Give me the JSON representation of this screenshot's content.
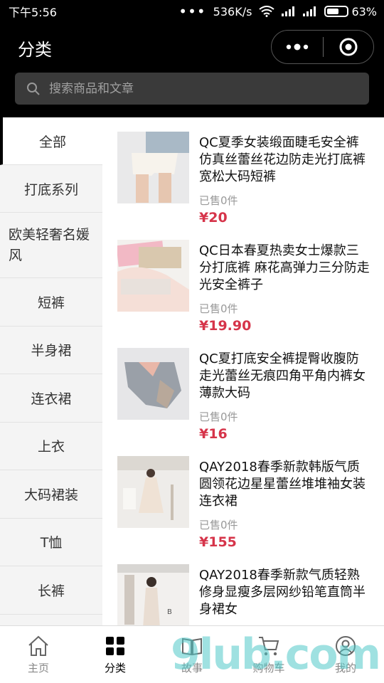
{
  "status_bar": {
    "time": "下午5:56",
    "speed": "536K/s",
    "battery": "63%",
    "battery_level": 0.63
  },
  "header": {
    "title": "分类",
    "search_placeholder": "搜索商品和文章"
  },
  "sidebar": {
    "items": [
      {
        "label": "全部",
        "active": true
      },
      {
        "label": "打底系列"
      },
      {
        "label": "欧美轻奢名媛风"
      },
      {
        "label": "短裤"
      },
      {
        "label": "半身裙"
      },
      {
        "label": "连衣裙"
      },
      {
        "label": "上衣"
      },
      {
        "label": "大码裙装"
      },
      {
        "label": "T恤"
      },
      {
        "label": "长裤"
      }
    ]
  },
  "products": [
    {
      "name": "QC夏季女装缎面睫毛安全裤仿真丝蕾丝花边防走光打底裤宽松大码短裤",
      "sold": "已售0件",
      "price": "¥20"
    },
    {
      "name": "QC日本春夏热卖女士爆款三分打底裤 麻花高弹力三分防走光安全裤子",
      "sold": "已售0件",
      "price": "¥19.90"
    },
    {
      "name": "QC夏打底安全裤提臀收腹防走光蕾丝无痕四角平角内裤女薄款大码",
      "sold": "已售0件",
      "price": "¥16"
    },
    {
      "name": "QAY2018春季新款韩版气质圆领花边星星蕾丝堆堆袖女装连衣裙",
      "sold": "已售0件",
      "price": "¥155"
    },
    {
      "name": "QAY2018春季新款气质轻熟修身显瘦多层网纱铅笔直筒半身裙女",
      "sold": "",
      "price": ""
    }
  ],
  "tabbar": {
    "tabs": [
      {
        "label": "主页",
        "icon": "home-icon"
      },
      {
        "label": "分类",
        "icon": "grid-icon",
        "active": true
      },
      {
        "label": "故事",
        "icon": "book-icon"
      },
      {
        "label": "购物车",
        "icon": "cart-icon"
      },
      {
        "label": "我的",
        "icon": "user-icon"
      }
    ]
  },
  "watermark": "9lub.com",
  "colors": {
    "price": "#d6344a",
    "header_bg": "#000000",
    "sidebar_bg": "#f4f4f4"
  }
}
